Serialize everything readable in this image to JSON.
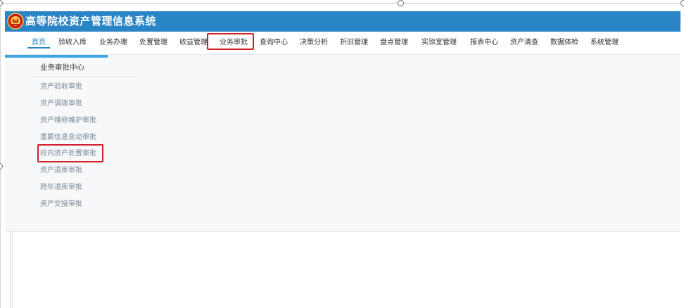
{
  "app": {
    "title": "高等院校资产管理信息系统",
    "emblem_icon": "national-emblem-icon",
    "header_color": "#2a85c6"
  },
  "nav": {
    "items": [
      "首页",
      "验收入库",
      "业务办理",
      "处置管理",
      "收益管理",
      "业务审批",
      "查询中心",
      "决策分析",
      "折旧管理",
      "盘点管理",
      "实验室管理",
      "报表中心",
      "资产清查",
      "数据体检",
      "系统管理"
    ],
    "active": "首页",
    "highlighted": "业务审批"
  },
  "submenu": {
    "title": "业务审批中心",
    "items": [
      "资产验收审批",
      "资产调拨审批",
      "资产维修维护审批",
      "重要信息变动审批",
      "校内资产处置审批",
      "资产退库审批",
      "跨年退库审批",
      "资产交接审批"
    ],
    "highlighted": "校内资产处置审批"
  },
  "colors": {
    "accent": "#2a85c6",
    "highlight_box": "#d0202a"
  }
}
